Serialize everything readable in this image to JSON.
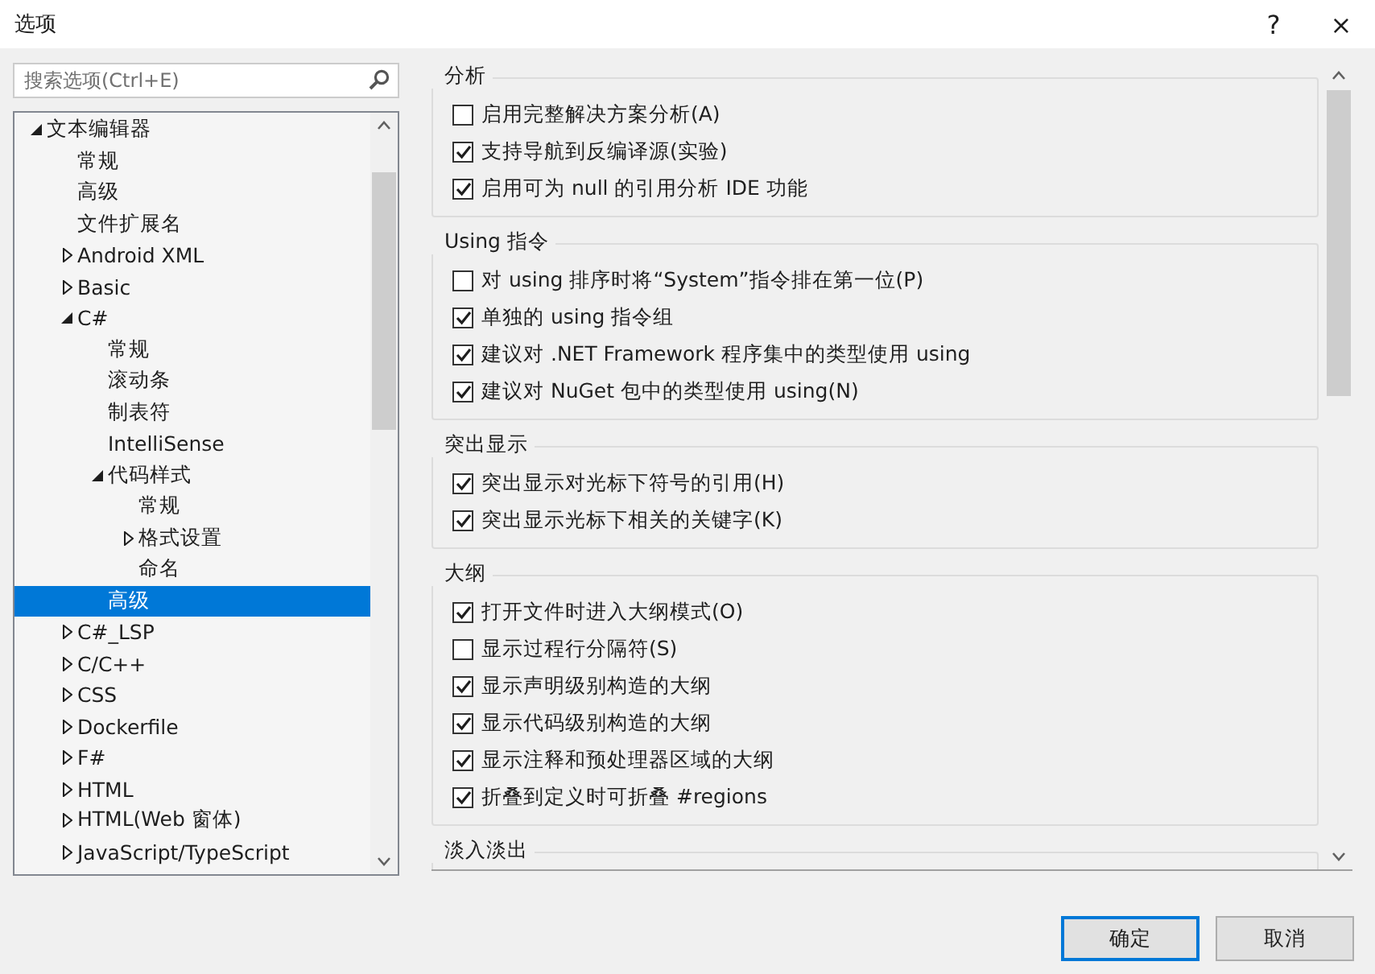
{
  "window": {
    "title": "选项",
    "help": "?",
    "close": "×"
  },
  "search": {
    "placeholder": "搜索选项(Ctrl+E)"
  },
  "tree": [
    {
      "label": "文本编辑器",
      "expanded": true,
      "selected": false,
      "children": [
        {
          "label": "常规",
          "selected": false
        },
        {
          "label": "高级",
          "selected": false
        },
        {
          "label": "文件扩展名",
          "selected": false
        },
        {
          "label": "Android XML",
          "expanded": false,
          "selected": false
        },
        {
          "label": "Basic",
          "expanded": false,
          "selected": false
        },
        {
          "label": "C#",
          "expanded": true,
          "selected": false,
          "children": [
            {
              "label": "常规",
              "selected": false
            },
            {
              "label": "滚动条",
              "selected": false
            },
            {
              "label": "制表符",
              "selected": false
            },
            {
              "label": "IntelliSense",
              "selected": false
            },
            {
              "label": "代码样式",
              "expanded": true,
              "selected": false,
              "children": [
                {
                  "label": "常规",
                  "selected": false
                },
                {
                  "label": "格式设置",
                  "expanded": false,
                  "selected": false
                },
                {
                  "label": "命名",
                  "selected": false
                }
              ]
            },
            {
              "label": "高级",
              "selected": true
            }
          ]
        },
        {
          "label": "C#_LSP",
          "expanded": false,
          "selected": false
        },
        {
          "label": "C/C++",
          "expanded": false,
          "selected": false
        },
        {
          "label": "CSS",
          "expanded": false,
          "selected": false
        },
        {
          "label": "Dockerfile",
          "expanded": false,
          "selected": false
        },
        {
          "label": "F#",
          "expanded": false,
          "selected": false
        },
        {
          "label": "HTML",
          "expanded": false,
          "selected": false
        },
        {
          "label": "HTML(Web 窗体)",
          "expanded": false,
          "selected": false
        },
        {
          "label": "JavaScript/TypeScript",
          "expanded": false,
          "selected": false
        }
      ]
    }
  ],
  "groups": [
    {
      "title": "分析",
      "options": [
        {
          "label": "启用完整解决方案分析(A)",
          "checked": false
        },
        {
          "label": "支持导航到反编译源(实验)",
          "checked": true
        },
        {
          "label": "启用可为 null 的引用分析 IDE 功能",
          "checked": true
        }
      ]
    },
    {
      "title": "Using 指令",
      "options": [
        {
          "label": "对 using 排序时将“System”指令排在第一位(P)",
          "checked": false
        },
        {
          "label": "单独的 using 指令组",
          "checked": true
        },
        {
          "label": "建议对 .NET Framework 程序集中的类型使用 using",
          "checked": true
        },
        {
          "label": "建议对 NuGet 包中的类型使用 using(N)",
          "checked": true
        }
      ]
    },
    {
      "title": "突出显示",
      "options": [
        {
          "label": "突出显示对光标下符号的引用(H)",
          "checked": true
        },
        {
          "label": "突出显示光标下相关的关键字(K)",
          "checked": true
        }
      ]
    },
    {
      "title": "大纲",
      "options": [
        {
          "label": "打开文件时进入大纲模式(O)",
          "checked": true
        },
        {
          "label": "显示过程行分隔符(S)",
          "checked": false
        },
        {
          "label": "显示声明级别构造的大纲",
          "checked": true
        },
        {
          "label": "显示代码级别构造的大纲",
          "checked": true
        },
        {
          "label": "显示注释和预处理器区域的大纲",
          "checked": true
        },
        {
          "label": "折叠到定义时可折叠 #regions",
          "checked": true
        }
      ]
    },
    {
      "title": "淡入淡出"
    }
  ],
  "buttons": [
    {
      "label": "确定",
      "kind": "primary"
    },
    {
      "label": "取消",
      "kind": "normal"
    }
  ]
}
